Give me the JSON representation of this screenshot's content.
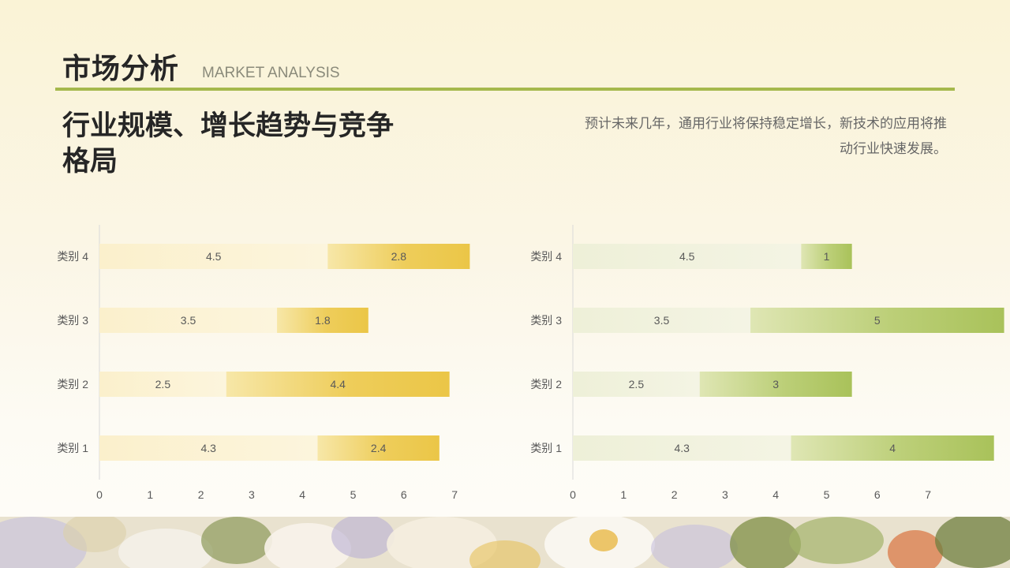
{
  "header": {
    "title": "市场分析",
    "subtitle_en": "MARKET ANALYSIS",
    "heading": "行业规模、增长趋势与竞争格局",
    "description": "预计未来几年，通用行业将保持稳定增长，新技术的应用将推动行业快速发展。"
  },
  "colors": {
    "accent_rule": "#a5b84c",
    "left_series1": "#fbf2d2",
    "left_series2": "#ecc64b",
    "right_series1": "#f1f2dd",
    "right_series2": "#acc45d"
  },
  "chart_data": [
    {
      "type": "bar",
      "orientation": "horizontal",
      "stacked": true,
      "categories": [
        "类别 1",
        "类别 2",
        "类别 3",
        "类别 4"
      ],
      "series": [
        {
          "values": [
            4.3,
            2.5,
            3.5,
            4.5
          ]
        },
        {
          "values": [
            2.4,
            4.4,
            1.8,
            2.8
          ]
        }
      ],
      "xlim": [
        0,
        7
      ],
      "xticks": [
        "0",
        "1",
        "2",
        "3",
        "4",
        "5",
        "6",
        "7"
      ],
      "grid": false,
      "data_labels": true
    },
    {
      "type": "bar",
      "orientation": "horizontal",
      "stacked": true,
      "categories": [
        "类别 1",
        "类别 2",
        "类别 3",
        "类别 4"
      ],
      "series": [
        {
          "values": [
            4.3,
            2.5,
            3.5,
            4.5
          ]
        },
        {
          "values": [
            4,
            3,
            5,
            1
          ]
        }
      ],
      "xlim": [
        0,
        7
      ],
      "xticks": [
        "0",
        "1",
        "2",
        "3",
        "4",
        "5",
        "6",
        "7"
      ],
      "grid": false,
      "data_labels": true
    }
  ]
}
